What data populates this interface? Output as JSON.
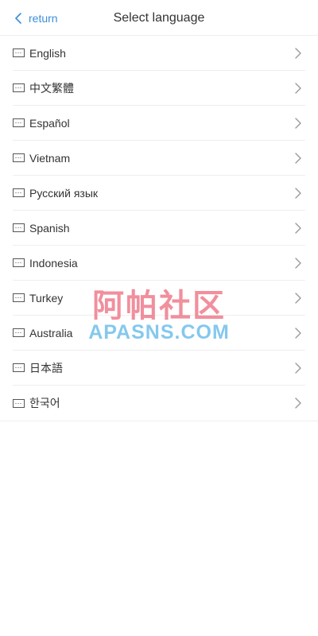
{
  "header": {
    "back_label": "return",
    "title": "Select language"
  },
  "languages": [
    {
      "label": "English"
    },
    {
      "label": "中文繁體"
    },
    {
      "label": "Español"
    },
    {
      "label": "Vietnam"
    },
    {
      "label": "Русский язык"
    },
    {
      "label": "Spanish"
    },
    {
      "label": "Indonesia"
    },
    {
      "label": "Turkey"
    },
    {
      "label": "Australia"
    },
    {
      "label": "日本語"
    },
    {
      "label": "한국어"
    }
  ],
  "icons": {
    "back": "chevron-left-icon",
    "row": "keyboard-icon",
    "row_arrow": "chevron-right-icon"
  },
  "watermark": {
    "chinese": "阿帕社区",
    "english": "APASNS.COM"
  },
  "colors": {
    "accent": "#3b8fd9",
    "text": "#333333",
    "divider": "#eeeeee",
    "chevron": "#999999",
    "watermark_pink": "#ec6a7c",
    "watermark_blue": "#6fbeeb"
  }
}
